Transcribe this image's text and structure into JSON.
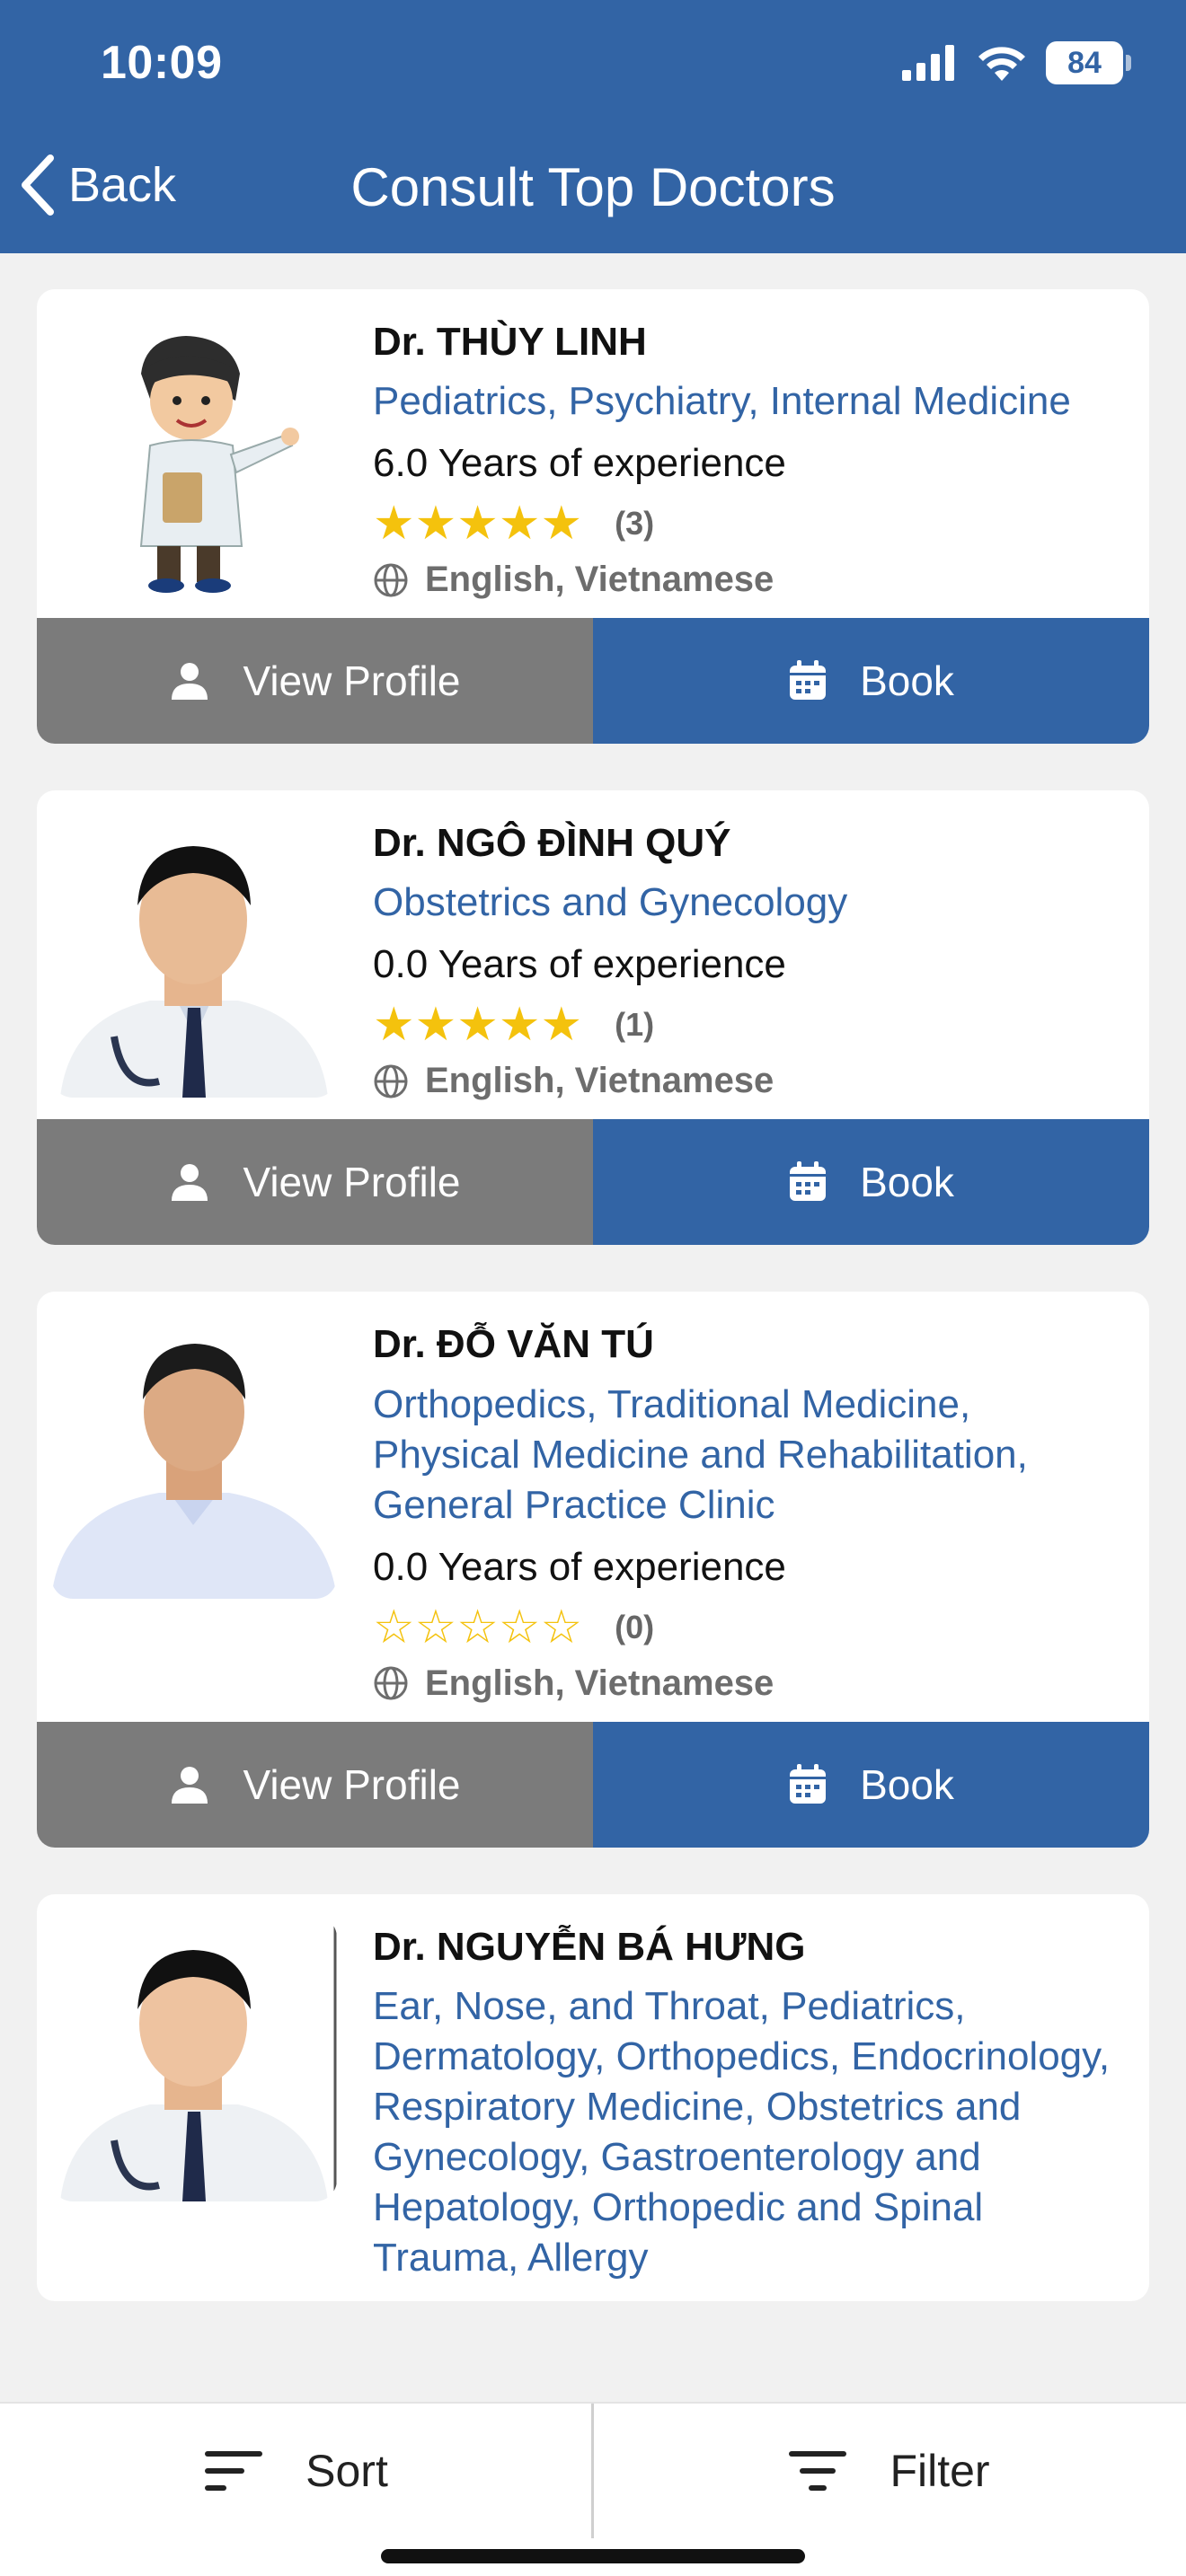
{
  "status": {
    "time": "10:09",
    "battery": "84"
  },
  "header": {
    "back_label": "Back",
    "title": "Consult Top Doctors"
  },
  "doctors": [
    {
      "name": "Dr. THÙY LINH",
      "specialty": "Pediatrics, Psychiatry, Internal Medicine",
      "experience": "6.0 Years of experience",
      "rating_count": "(3)",
      "stars": 5,
      "languages": "English, Vietnamese",
      "avatar": "cartoon-doctor"
    },
    {
      "name": "Dr. NGÔ ĐÌNH QUÝ",
      "specialty": "Obstetrics and Gynecology",
      "experience": "0.0 Years of experience",
      "rating_count": "(1)",
      "stars": 5,
      "languages": "English, Vietnamese",
      "avatar": "doctor-photo"
    },
    {
      "name": "Dr. ĐỖ VĂN TÚ",
      "specialty": "Orthopedics, Traditional Medicine, Physical Medicine and Rehabilitation, General Practice Clinic",
      "experience": "0.0 Years of experience",
      "rating_count": "(0)",
      "stars": 0,
      "languages": "English, Vietnamese",
      "avatar": "doctor-photo"
    },
    {
      "name": "Dr. NGUYỄN BÁ HƯNG",
      "specialty": "Ear, Nose, and Throat, Pediatrics, Dermatology, Orthopedics, Endocrinology, Respiratory Medicine, Obstetrics and Gynecology, Gastroenterology and Hepatology, Orthopedic and Spinal Trauma, Allergy",
      "avatar": "doctor-photo"
    }
  ],
  "buttons": {
    "view_profile": "View Profile",
    "book": "Book"
  },
  "bottom": {
    "sort": "Sort",
    "filter": "Filter"
  },
  "colors": {
    "primary": "#3264a5",
    "secondary_button": "#7b7b7b",
    "star": "#f4c20d"
  }
}
